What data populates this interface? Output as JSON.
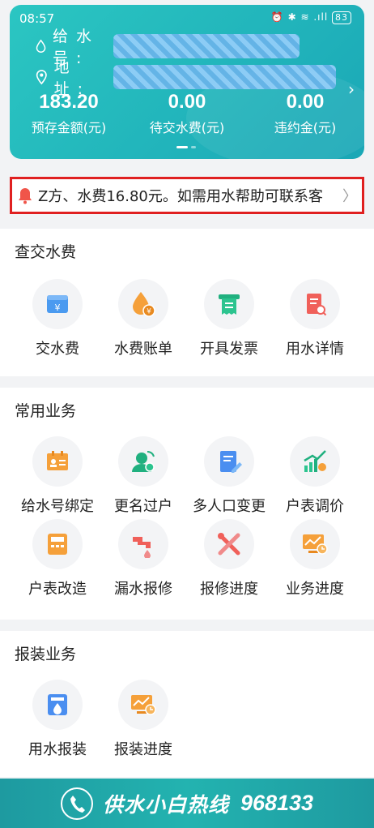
{
  "status_bar": {
    "time": "08:57",
    "icons": "⏰ ✱ ≋ .ıll",
    "battery": "83"
  },
  "account": {
    "water_no_label": "给水号:",
    "address_label": "地 址:",
    "stats": [
      {
        "value": "183.20",
        "label": "预存金额(元)"
      },
      {
        "value": "0.00",
        "label": "待交水费(元)"
      },
      {
        "value": "0.00",
        "label": "违约金(元)"
      }
    ]
  },
  "notice": {
    "text": "Z方、水费16.80元。如需用水帮助可联系客",
    "arrow": "〉"
  },
  "sections": [
    {
      "title": "查交水费",
      "items": [
        {
          "label": "交水费",
          "icon": "payment-icon"
        },
        {
          "label": "水费账单",
          "icon": "bill-icon"
        },
        {
          "label": "开具发票",
          "icon": "invoice-icon"
        },
        {
          "label": "用水详情",
          "icon": "usage-detail-icon"
        }
      ]
    },
    {
      "title": "常用业务",
      "items": [
        {
          "label": "给水号绑定",
          "icon": "bind-icon"
        },
        {
          "label": "更名过户",
          "icon": "transfer-icon"
        },
        {
          "label": "多人口变更",
          "icon": "edit-icon"
        },
        {
          "label": "户表调价",
          "icon": "price-adjust-icon"
        },
        {
          "label": "户表改造",
          "icon": "meter-icon"
        },
        {
          "label": "漏水报修",
          "icon": "leak-icon"
        },
        {
          "label": "报修进度",
          "icon": "repair-icon"
        },
        {
          "label": "业务进度",
          "icon": "progress-icon"
        }
      ]
    },
    {
      "title": "报装业务",
      "items": [
        {
          "label": "用水报装",
          "icon": "install-icon"
        },
        {
          "label": "报装进度",
          "icon": "install-progress-icon"
        }
      ]
    }
  ],
  "hotline": {
    "text": "供水小白热线",
    "number": "968133"
  },
  "colors": {
    "brand": "#1fb2b8",
    "accent_orange": "#f5a03a",
    "alert": "#e02020"
  }
}
